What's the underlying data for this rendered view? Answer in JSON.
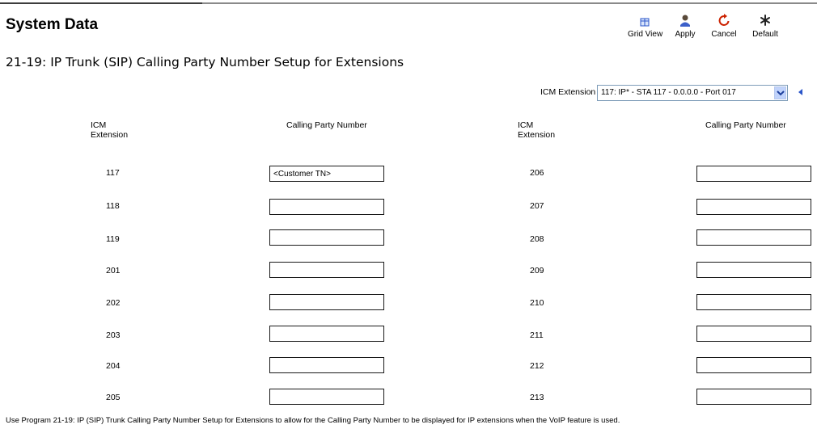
{
  "header": {
    "title": "System Data"
  },
  "toolbar": {
    "grid_view": {
      "label": "Grid View",
      "icon": "grid-view-icon"
    },
    "apply": {
      "label": "Apply",
      "icon": "apply-icon"
    },
    "cancel": {
      "label": "Cancel",
      "icon": "cancel-icon"
    },
    "default": {
      "label": "Default",
      "icon": "asterisk-icon"
    }
  },
  "program_title": "21-19: IP Trunk (SIP) Calling Party Number Setup for Extensions",
  "selector": {
    "label": "ICM Extension",
    "value": "117: IP* - STA 117 - 0.0.0.0 - Port 017"
  },
  "columns": {
    "extension": "ICM Extension",
    "calling_party_number": "Calling Party Number"
  },
  "left_rows": [
    {
      "ext": "117",
      "value": "<Customer TN>"
    },
    {
      "ext": "118",
      "value": ""
    },
    {
      "ext": "119",
      "value": ""
    },
    {
      "ext": "201",
      "value": ""
    },
    {
      "ext": "202",
      "value": ""
    },
    {
      "ext": "203",
      "value": ""
    },
    {
      "ext": "204",
      "value": ""
    },
    {
      "ext": "205",
      "value": ""
    }
  ],
  "right_rows": [
    {
      "ext": "206",
      "value": ""
    },
    {
      "ext": "207",
      "value": ""
    },
    {
      "ext": "208",
      "value": ""
    },
    {
      "ext": "209",
      "value": ""
    },
    {
      "ext": "210",
      "value": ""
    },
    {
      "ext": "211",
      "value": ""
    },
    {
      "ext": "212",
      "value": ""
    },
    {
      "ext": "213",
      "value": ""
    }
  ],
  "footer_note": "Use Program 21-19: IP (SIP) Trunk Calling Party Number Setup for Extensions to allow for the Calling Party Number to be displayed for IP extensions when the VoIP feature is used.",
  "colors": {
    "accent_blue": "#2a55c9",
    "cancel_red": "#cc2200",
    "input_border": "#1a1a1a"
  }
}
